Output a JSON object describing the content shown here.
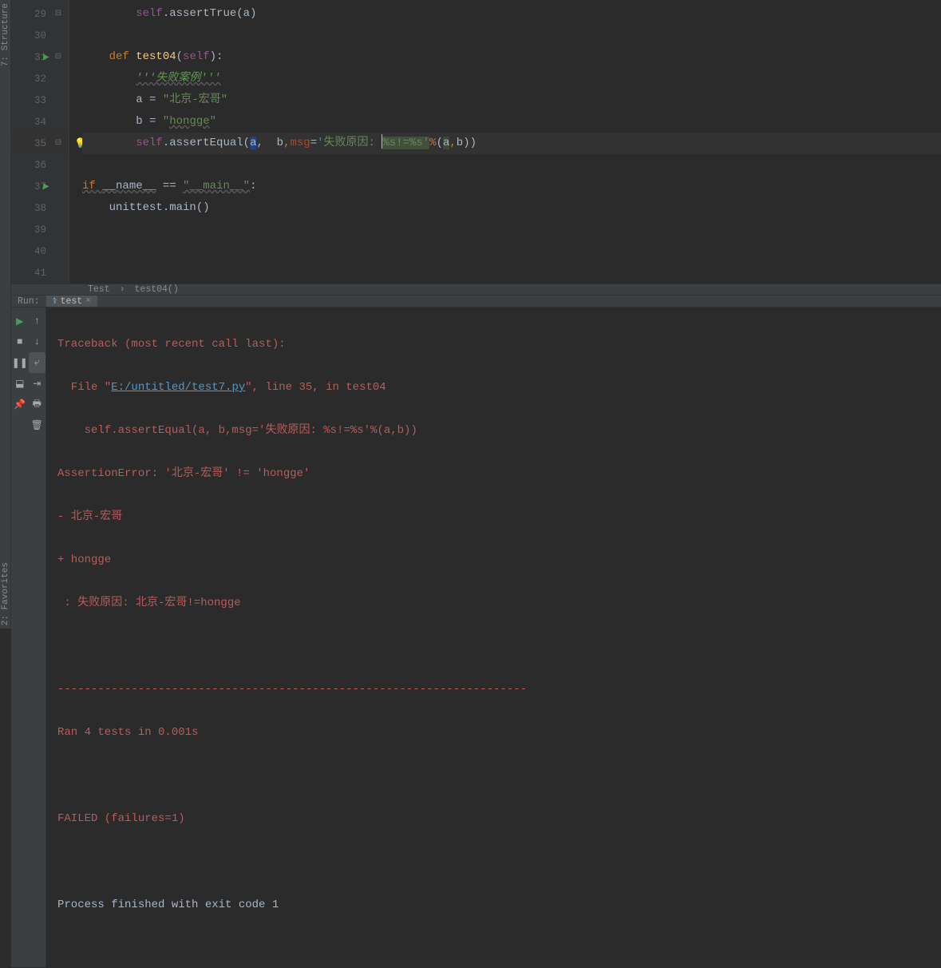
{
  "left_rail": {
    "top": "7: Structure",
    "bottom": "2: Favorites"
  },
  "gutter": {
    "lines": [
      29,
      30,
      31,
      32,
      33,
      34,
      35,
      36,
      37,
      38,
      39,
      40,
      41
    ],
    "run_markers": [
      31,
      37
    ],
    "fold_open": [
      29
    ],
    "fold_start": [
      31,
      35
    ],
    "bulb": 35,
    "current": 35
  },
  "code": {
    "l29": {
      "indent": "        ",
      "self": "self",
      "dot": ".",
      "fn": "assertTrue",
      "open": "(",
      "arg": "a",
      "close": ")"
    },
    "l31": {
      "indent": "    ",
      "def": "def ",
      "name": "test04",
      "open": "(",
      "param": "self",
      "close": "):"
    },
    "l32": {
      "indent": "        ",
      "doc": "'''失败案例'''"
    },
    "l33": {
      "indent": "        ",
      "var": "a ",
      "eq": "= ",
      "str": "\"北京-宏哥\""
    },
    "l34": {
      "indent": "        ",
      "var": "b ",
      "eq": "= ",
      "q1": "\"",
      "link": "hongge",
      "q2": "\""
    },
    "l35": {
      "indent": "        ",
      "self": "self",
      "dot": ".",
      "fn": "assertEqual",
      "open": "(",
      "a": "a",
      "c1": ", ",
      "b": " b",
      "c2": ",",
      "msg": "msg",
      "eq": "=",
      "s1": "'失败原因: ",
      "s2": "%s!=%s'",
      "pct": "%",
      "open2": "(",
      "aa": "a",
      "c3": ",",
      "bb": "b",
      "close": "))"
    },
    "l37": {
      "if": "if ",
      "name": "__name__",
      "sp": " ",
      "eq": "== ",
      "main": "\"__main__\"",
      "colon": ":"
    },
    "l38": {
      "indent": "    ",
      "mod": "unittest.main()"
    }
  },
  "breadcrumb": {
    "a": "Test",
    "sep": "›",
    "b": "test04()"
  },
  "run": {
    "label": "Run:",
    "tab": "test"
  },
  "console": {
    "l1": "Traceback (most recent call last):",
    "l2a": "  File \"",
    "l2link": "E:/untitled/test7.py",
    "l2b": "\", line 35, in test04",
    "l3": "    self.assertEqual(a, b,msg='失败原因: %s!=%s'%(a,b))",
    "l4": "AssertionError: '北京-宏哥' != 'hongge'",
    "l5": "- 北京-宏哥",
    "l6": "+ hongge",
    "l7": " : 失败原因: 北京-宏哥!=hongge",
    "l8": "----------------------------------------------------------------------",
    "l9": "Ran 4 tests in 0.001s",
    "l10": "FAILED (failures=1)",
    "l11": "Process finished with exit code 1"
  }
}
